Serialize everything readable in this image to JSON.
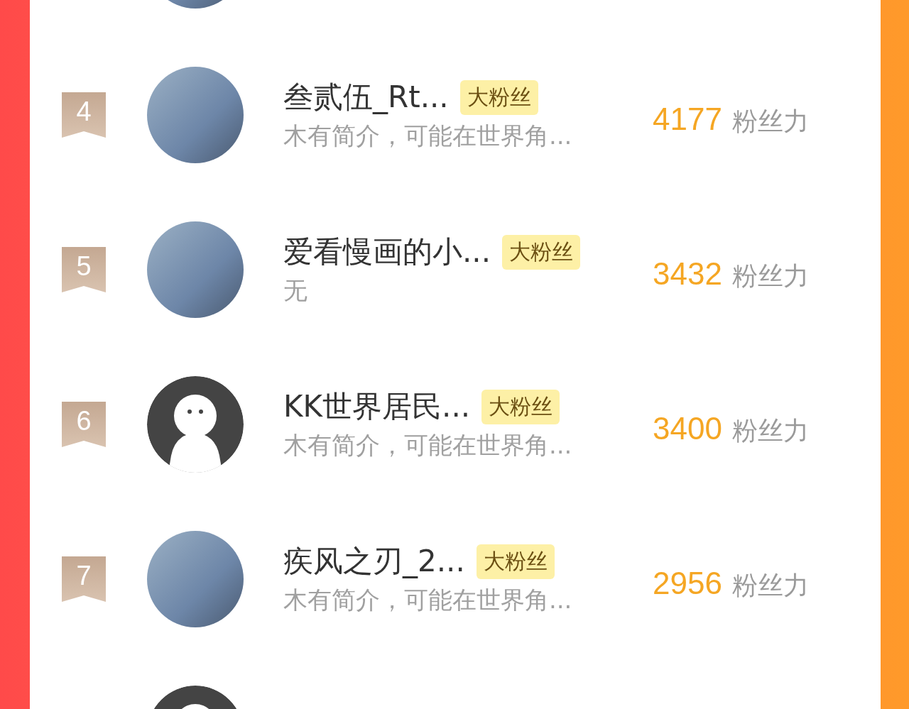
{
  "rows": [
    {
      "kind": "photo"
    },
    {
      "rank": "4",
      "kind": "photo",
      "name": "叁贰伍_Rt...",
      "badge": "大粉丝",
      "bio": "木有简介，可能在世界角...",
      "score": "4177",
      "score_label": "粉丝力"
    },
    {
      "rank": "5",
      "kind": "photo",
      "name": "爱看慢画的小...",
      "badge": "大粉丝",
      "bio": "无",
      "score": "3432",
      "score_label": "粉丝力"
    },
    {
      "rank": "6",
      "kind": "default",
      "name": "KK世界居民...",
      "badge": "大粉丝",
      "bio": "木有简介，可能在世界角...",
      "score": "3400",
      "score_label": "粉丝力"
    },
    {
      "rank": "7",
      "kind": "photo",
      "name": "疾风之刃_2...",
      "badge": "大粉丝",
      "bio": "木有简介，可能在世界角...",
      "score": "2956",
      "score_label": "粉丝力"
    },
    {
      "kind": "default"
    }
  ]
}
